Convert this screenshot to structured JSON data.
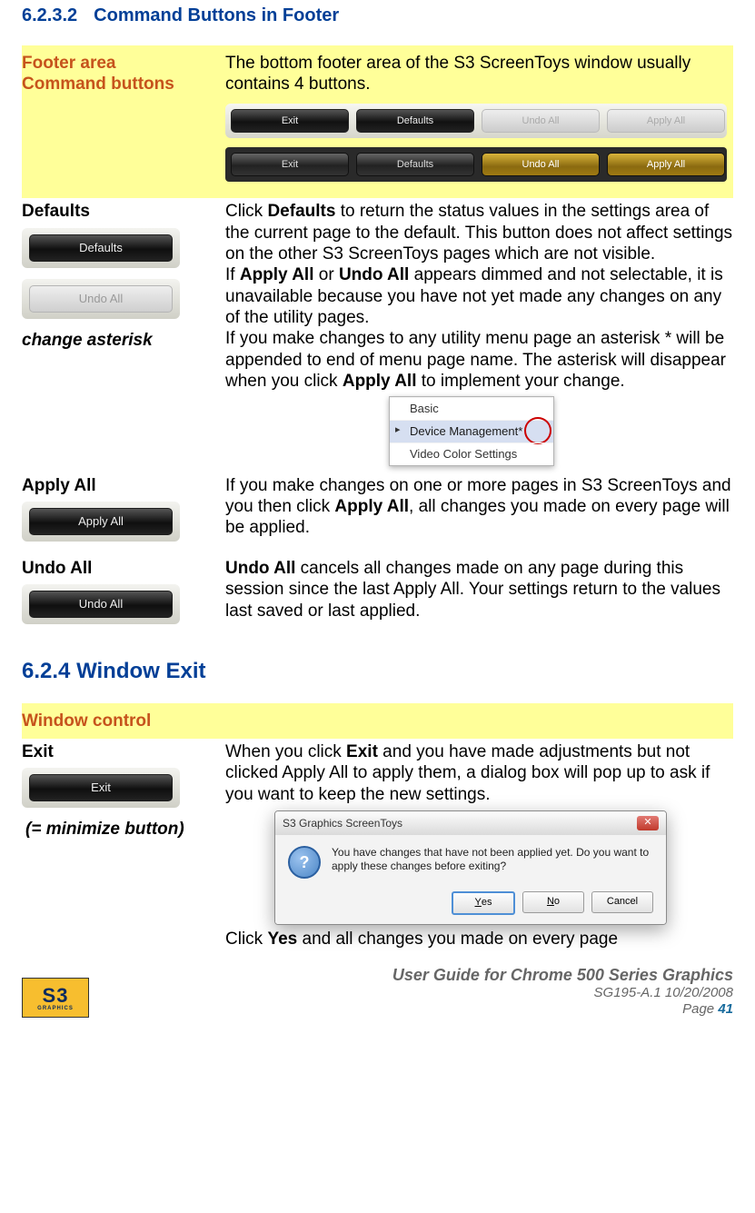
{
  "section1": {
    "number": "6.2.3.2",
    "title": "Command Buttons in Footer",
    "rows": [
      {
        "label": "Footer area\nCommand buttons",
        "text": "The bottom footer area of the S3 ScreenToys window usually contains 4 buttons."
      }
    ],
    "footer_bar_buttons": {
      "exit": "Exit",
      "defaults": "Defaults",
      "undo_all": "Undo All",
      "apply_all": "Apply All"
    },
    "defaults_row": {
      "label1": "Defaults",
      "btn1": "Defaults",
      "btn2": "Undo All",
      "label2": "change asterisk",
      "p1a": "Click ",
      "p1b": "Defaults",
      "p1c": " to return the status values in the settings area of the current page to the default. This button does not affect settings on the other S3 ScreenToys pages which are not visible.",
      "p2a": "If ",
      "p2b": "Apply All",
      "p2c": " or ",
      "p2d": "Undo All",
      "p2e": " appears dimmed and not selectable, it is unavailable because you have not yet made any changes on any of the utility pages.",
      "p3a": "If you make changes to any utility menu page an asterisk * will be appended to end of menu page name. The asterisk will disappear when you click ",
      "p3b": "Apply All",
      "p3c": " to implement your change.",
      "menu": {
        "i0": "Basic",
        "i1": "Device Management*",
        "i2": "Video Color Settings"
      }
    },
    "applyall_row": {
      "label": "Apply All",
      "btn": "Apply All",
      "p1a": "If you make changes on one or more pages in S3 ScreenToys and you then click ",
      "p1b": "Apply All",
      "p1c": ", all changes you made on every page will be applied."
    },
    "undoall_row": {
      "label": "Undo All",
      "btn": "Undo All",
      "p1a": "Undo All",
      "p1b": " cancels all changes made on any page during this session since the last Apply All. Your settings return to the values last saved or last applied."
    }
  },
  "section2": {
    "number": "6.2.4",
    "title": "Window Exit",
    "header_label": "Window control",
    "exit_row": {
      "label": "Exit",
      "btn": "Exit",
      "sub": "(= minimize button)",
      "p1a": "When you click ",
      "p1b": "Exit",
      "p1c": " and you have made adjustments but not clicked Apply All to apply them, a dialog box will pop up to ask if you want to keep the new settings.",
      "dialog": {
        "title": "S3 Graphics ScreenToys",
        "msg": "You have changes that have not been applied yet.  Do you want to apply these changes before exiting?",
        "yes": "Yes",
        "no": "No",
        "cancel": "Cancel"
      },
      "p2a": "Click ",
      "p2b": "Yes",
      "p2c": " and all changes you made on every page"
    }
  },
  "footer": {
    "logo_top": "S3",
    "logo_sub": "GRAPHICS",
    "line1": "User Guide for Chrome 500 Series Graphics",
    "line2": "SG195-A.1   10/20/2008",
    "line3_label": "Page ",
    "line3_num": "41"
  }
}
